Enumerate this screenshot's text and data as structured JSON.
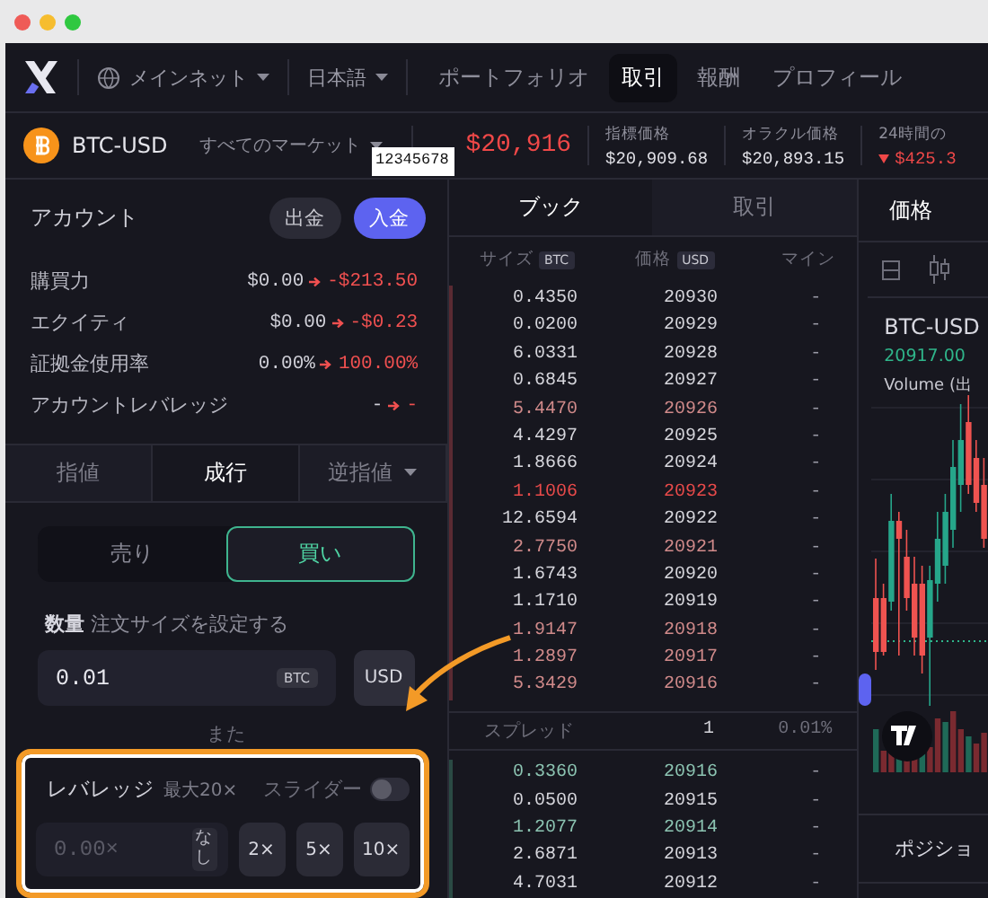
{
  "nav": {
    "network": "メインネット",
    "language": "日本語",
    "tabs": [
      {
        "label": "ポートフォリオ",
        "selected": false
      },
      {
        "label": "取引",
        "selected": true
      },
      {
        "label": "報酬",
        "selected": false
      },
      {
        "label": "プロフィール",
        "selected": false
      }
    ]
  },
  "market": {
    "symbol": "BTC-USD",
    "selector": "すべてのマーケット",
    "price": "$20,916",
    "stats": [
      {
        "label": "指標価格",
        "value": "$20,909.68",
        "kind": "plain"
      },
      {
        "label": "オラクル価格",
        "value": "$20,893.15",
        "kind": "plain"
      },
      {
        "label": "24時間の",
        "value": "$425.3",
        "kind": "down"
      }
    ]
  },
  "tooltip": "12345678",
  "account": {
    "title": "アカウント",
    "buttons": [
      {
        "label": "出金",
        "kind": "secondary"
      },
      {
        "label": "入金",
        "kind": "primary"
      }
    ],
    "rows": [
      {
        "label": "購買力",
        "current": "$0.00",
        "projected": "-$213.50"
      },
      {
        "label": "エクイティ",
        "current": "$0.00",
        "projected": "-$0.23"
      },
      {
        "label": "証拠金使用率",
        "current": "0.00%",
        "projected": "100.00%"
      },
      {
        "label": "アカウントレバレッジ",
        "current": "-",
        "projected": "-"
      }
    ]
  },
  "order_types": [
    {
      "label": "指値",
      "selected": false,
      "dropdown": false
    },
    {
      "label": "成行",
      "selected": true,
      "dropdown": false
    },
    {
      "label": "逆指値",
      "selected": false,
      "dropdown": true
    }
  ],
  "sides": [
    {
      "label": "売り",
      "selected": false
    },
    {
      "label": "買い",
      "selected": true
    }
  ],
  "amount": {
    "label": "数量",
    "hint": "注文サイズを設定する",
    "value": "0.01",
    "unit": "BTC",
    "toggle": "USD"
  },
  "separator": "また",
  "leverage": {
    "highlighted": true,
    "label": "レバレッジ",
    "max": "最大20×",
    "slider_label": "スライダー",
    "slider_on": false,
    "placeholder": "0.00×",
    "none": "なし",
    "presets": [
      "2×",
      "5×",
      "10×"
    ]
  },
  "book": {
    "tabs": [
      {
        "label": "ブック",
        "selected": true
      },
      {
        "label": "取引",
        "selected": false
      }
    ],
    "columns": [
      {
        "label": "サイズ",
        "unit": "BTC"
      },
      {
        "label": "価格",
        "unit": "USD"
      },
      {
        "label": "マイン"
      }
    ],
    "asks": [
      {
        "size": "0.4350",
        "price": "20930",
        "mine": "-",
        "color": "#d6d6dc"
      },
      {
        "size": "0.0200",
        "price": "20929",
        "mine": "-",
        "color": "#d6d6dc"
      },
      {
        "size": "6.0331",
        "price": "20928",
        "mine": "-",
        "color": "#d6d6dc"
      },
      {
        "size": "0.6845",
        "price": "20927",
        "mine": "-",
        "color": "#d6d6dc"
      },
      {
        "size": "5.4470",
        "price": "20926",
        "mine": "-",
        "color": "#d08a8a"
      },
      {
        "size": "4.4297",
        "price": "20925",
        "mine": "-",
        "color": "#d6d6dc"
      },
      {
        "size": "1.8666",
        "price": "20924",
        "mine": "-",
        "color": "#d6d6dc"
      },
      {
        "size": "1.1006",
        "price": "20923",
        "mine": "-",
        "color": "#e84a4a"
      },
      {
        "size": "12.6594",
        "price": "20922",
        "mine": "-",
        "color": "#d6d6dc"
      },
      {
        "size": "2.7750",
        "price": "20921",
        "mine": "-",
        "color": "#d08a8a"
      },
      {
        "size": "1.6743",
        "price": "20920",
        "mine": "-",
        "color": "#d6d6dc"
      },
      {
        "size": "1.1710",
        "price": "20919",
        "mine": "-",
        "color": "#d6d6dc"
      },
      {
        "size": "1.9147",
        "price": "20918",
        "mine": "-",
        "color": "#d08a8a"
      },
      {
        "size": "1.2897",
        "price": "20917",
        "mine": "-",
        "color": "#d08a8a"
      },
      {
        "size": "5.3429",
        "price": "20916",
        "mine": "-",
        "color": "#d08a8a"
      }
    ],
    "spread": {
      "label": "スプレッド",
      "value": "1",
      "percent": "0.01%"
    },
    "bids": [
      {
        "size": "0.3360",
        "price": "20916",
        "mine": "-",
        "color": "#8cc4b2"
      },
      {
        "size": "0.0500",
        "price": "20915",
        "mine": "-",
        "color": "#d6d6dc"
      },
      {
        "size": "1.2077",
        "price": "20914",
        "mine": "-",
        "color": "#8cc4b2"
      },
      {
        "size": "2.6871",
        "price": "20913",
        "mine": "-",
        "color": "#d6d6dc"
      },
      {
        "size": "4.7031",
        "price": "20912",
        "mine": "-",
        "color": "#d6d6dc"
      }
    ]
  },
  "chart": {
    "tabs": [
      {
        "label": "価格",
        "selected": true
      }
    ],
    "symbol": "BTC-USD",
    "last": "20917.00",
    "indicator": "Volume (出"
  },
  "positions": {
    "label": "ポジショ"
  }
}
